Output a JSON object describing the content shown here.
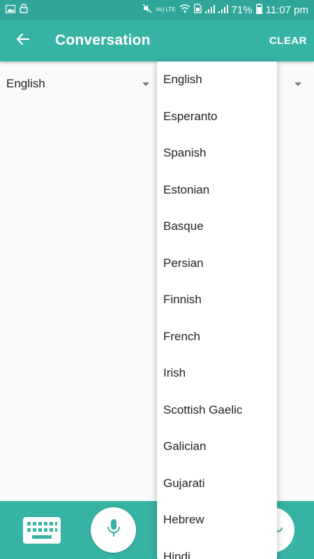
{
  "status_bar": {
    "battery": "71%",
    "time": "11:07 pm",
    "network_label": "Vo) LTE"
  },
  "app_bar": {
    "title": "Conversation",
    "clear_label": "CLEAR",
    "back_icon": "arrow-left-icon"
  },
  "language_selectors": {
    "source_language": "English"
  },
  "dropdown": {
    "items": [
      "English",
      "Esperanto",
      "Spanish",
      "Estonian",
      "Basque",
      "Persian",
      "Finnish",
      "French",
      "Irish",
      "Scottish Gaelic",
      "Galician",
      "Gujarati",
      "Hebrew",
      "Hindi"
    ]
  },
  "bottom_bar": {
    "keyboard_icon": "keyboard-icon",
    "mic_icon": "microphone-icon"
  },
  "colors": {
    "primary": "#36b3a3",
    "status_bar": "#2fa697",
    "background": "#fafafa"
  }
}
